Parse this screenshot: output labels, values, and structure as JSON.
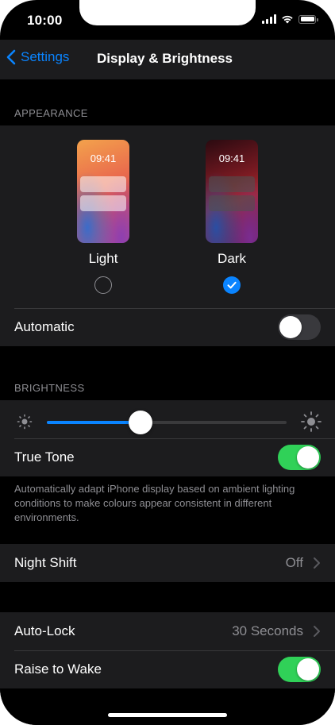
{
  "status_bar": {
    "time": "10:00"
  },
  "nav": {
    "back_label": "Settings",
    "title": "Display & Brightness"
  },
  "appearance": {
    "header": "APPEARANCE",
    "light": {
      "preview_time": "09:41",
      "label": "Light",
      "selected": false
    },
    "dark": {
      "preview_time": "09:41",
      "label": "Dark",
      "selected": true
    },
    "automatic": {
      "label": "Automatic",
      "on": false
    }
  },
  "brightness": {
    "header": "BRIGHTNESS",
    "level": 0.39,
    "true_tone": {
      "label": "True Tone",
      "on": true
    },
    "footnote": "Automatically adapt iPhone display based on ambient lighting conditions to make colours appear consistent in different environments."
  },
  "night_shift": {
    "label": "Night Shift",
    "value": "Off"
  },
  "auto_lock": {
    "label": "Auto-Lock",
    "value": "30 Seconds"
  },
  "raise_to_wake": {
    "label": "Raise to Wake",
    "on": true
  },
  "colors": {
    "accent": "#0a84ff",
    "toggle_on": "#30d158",
    "toggle_off": "#39393d",
    "cell_background": "#1c1c1e",
    "background": "#000000",
    "secondary_text": "#8e8e93"
  }
}
